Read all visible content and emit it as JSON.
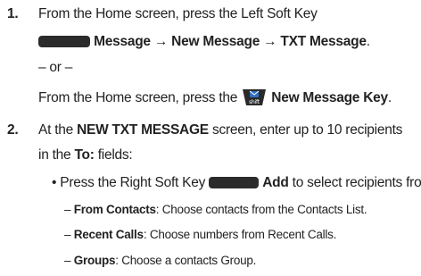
{
  "steps": [
    {
      "number": "1.",
      "line1": "From the Home screen, press the Left Soft Key",
      "line2": "Message → New Message → TXT Message",
      "line2_end": ".",
      "or": "– or –",
      "line4_pre": "From the Home screen, press the",
      "line4_key": "New Message Key",
      "line4_end": "."
    },
    {
      "number": "2.",
      "line1_pre": "At the ",
      "line1_bold": "NEW TXT MESSAGE",
      "line1_post": " screen, enter up to 10 recipients",
      "line2_pre": "in the ",
      "line2_bold": "To:",
      "line2_post": " fields:",
      "bullet": "•",
      "bullet_pre": "Press the Right Soft Key",
      "bullet_bold": "Add",
      "bullet_post": " to select recipients from:",
      "subitems": [
        {
          "dash": "–",
          "bold": "From Contacts",
          "text": ": Choose contacts from the Contacts List."
        },
        {
          "dash": "–",
          "bold": "Recent Calls",
          "text": ": Choose numbers from Recent Calls."
        },
        {
          "dash": "–",
          "bold": "Groups",
          "text": ": Choose a contacts Group."
        }
      ]
    }
  ],
  "icons": {
    "left_soft_key": "soft-key-icon",
    "new_message_key": "new-message-key-icon",
    "new_message_key_label": "shift",
    "right_soft_key": "soft-key-icon"
  },
  "colors": {
    "text": "#222222",
    "key": "#2b2b2b",
    "msg_key_blue": "#2f6fc0"
  }
}
